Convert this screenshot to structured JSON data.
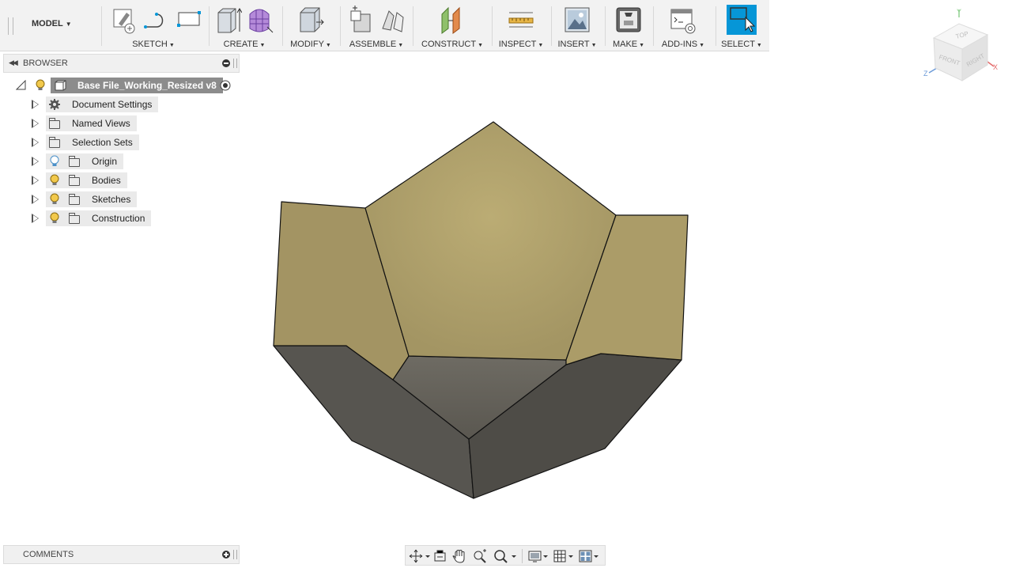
{
  "toolbar": {
    "workspace": "MODEL",
    "groups": {
      "sketch": "SKETCH",
      "create": "CREATE",
      "modify": "MODIFY",
      "assemble": "ASSEMBLE",
      "construct": "CONSTRUCT",
      "inspect": "INSPECT",
      "insert": "INSERT",
      "make": "MAKE",
      "addins": "ADD-INS",
      "select": "SELECT"
    },
    "accent": "#0696d7"
  },
  "browser": {
    "title": "BROWSER",
    "root": "Base File_Working_Resized v8",
    "items": [
      {
        "label": "Document Settings",
        "icon": "gear-icon",
        "bulb": "none"
      },
      {
        "label": "Named Views",
        "icon": "folder-icon",
        "bulb": "none"
      },
      {
        "label": "Selection Sets",
        "icon": "folder-icon",
        "bulb": "none"
      },
      {
        "label": "Origin",
        "icon": "folder-icon",
        "bulb": "off"
      },
      {
        "label": "Bodies",
        "icon": "folder-icon",
        "bulb": "on"
      },
      {
        "label": "Sketches",
        "icon": "folder-icon",
        "bulb": "on"
      },
      {
        "label": "Construction",
        "icon": "folder-icon",
        "bulb": "on"
      }
    ]
  },
  "comments": {
    "title": "COMMENTS"
  },
  "viewcube": {
    "top": "TOP",
    "front": "FRONT",
    "right": "RIGHT",
    "axis_x": "X",
    "axis_y": "Y",
    "axis_z": "Z"
  },
  "colors": {
    "body_light": "#b8a86e",
    "body_dark": "#5e5b53",
    "bulb_on": "#f2c94c",
    "bulb_off": "#6ab0de"
  }
}
